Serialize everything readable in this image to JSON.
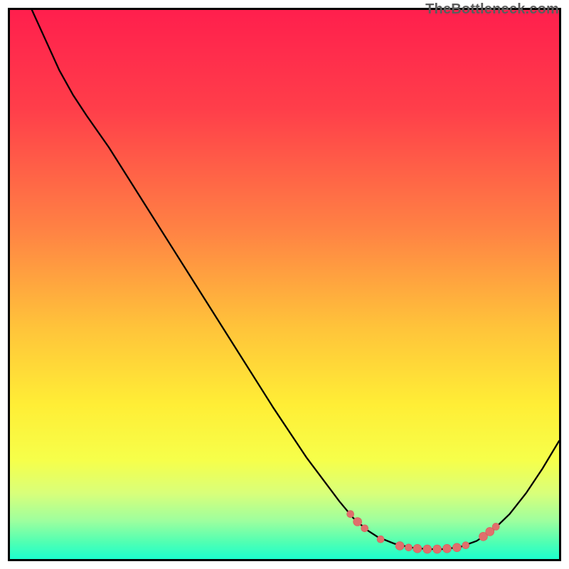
{
  "watermark": "TheBottleneck.com",
  "chart_data": {
    "type": "line",
    "title": "",
    "xlabel": "",
    "ylabel": "",
    "xlim": [
      0,
      100
    ],
    "ylim": [
      0,
      100
    ],
    "gradient_stops": [
      {
        "offset": 0,
        "color": "#ff1f4d"
      },
      {
        "offset": 18,
        "color": "#ff3e4a"
      },
      {
        "offset": 40,
        "color": "#ff8244"
      },
      {
        "offset": 58,
        "color": "#ffc43a"
      },
      {
        "offset": 72,
        "color": "#ffee36"
      },
      {
        "offset": 82,
        "color": "#f6ff4a"
      },
      {
        "offset": 88,
        "color": "#d9ff7a"
      },
      {
        "offset": 93,
        "color": "#9eff9e"
      },
      {
        "offset": 97,
        "color": "#4fffb3"
      },
      {
        "offset": 100,
        "color": "#1cffce"
      }
    ],
    "curve": [
      {
        "x": 4.0,
        "y": 100.0
      },
      {
        "x": 6.5,
        "y": 94.5
      },
      {
        "x": 9.0,
        "y": 89.0
      },
      {
        "x": 11.5,
        "y": 84.5
      },
      {
        "x": 14.0,
        "y": 80.7
      },
      {
        "x": 18.0,
        "y": 75.0
      },
      {
        "x": 24.0,
        "y": 65.5
      },
      {
        "x": 30.0,
        "y": 56.0
      },
      {
        "x": 36.0,
        "y": 46.5
      },
      {
        "x": 42.0,
        "y": 37.0
      },
      {
        "x": 48.0,
        "y": 27.5
      },
      {
        "x": 54.0,
        "y": 18.5
      },
      {
        "x": 60.0,
        "y": 10.5
      },
      {
        "x": 62.5,
        "y": 7.5
      },
      {
        "x": 65.0,
        "y": 5.3
      },
      {
        "x": 67.0,
        "y": 4.0
      },
      {
        "x": 70.0,
        "y": 2.8
      },
      {
        "x": 73.0,
        "y": 2.1
      },
      {
        "x": 76.0,
        "y": 1.8
      },
      {
        "x": 79.0,
        "y": 1.8
      },
      {
        "x": 82.0,
        "y": 2.2
      },
      {
        "x": 85.0,
        "y": 3.3
      },
      {
        "x": 88.0,
        "y": 5.3
      },
      {
        "x": 91.0,
        "y": 8.2
      },
      {
        "x": 94.0,
        "y": 12.0
      },
      {
        "x": 97.0,
        "y": 16.5
      },
      {
        "x": 100.0,
        "y": 21.5
      }
    ],
    "markers": [
      {
        "x": 62.0,
        "y": 8.2,
        "r": 5
      },
      {
        "x": 63.3,
        "y": 6.8,
        "r": 6
      },
      {
        "x": 64.6,
        "y": 5.6,
        "r": 5
      },
      {
        "x": 67.5,
        "y": 3.6,
        "r": 5
      },
      {
        "x": 71.0,
        "y": 2.4,
        "r": 6
      },
      {
        "x": 72.6,
        "y": 2.1,
        "r": 5
      },
      {
        "x": 74.2,
        "y": 1.9,
        "r": 6
      },
      {
        "x": 76.0,
        "y": 1.8,
        "r": 6
      },
      {
        "x": 77.8,
        "y": 1.8,
        "r": 6
      },
      {
        "x": 79.6,
        "y": 1.9,
        "r": 6
      },
      {
        "x": 81.4,
        "y": 2.1,
        "r": 6
      },
      {
        "x": 83.0,
        "y": 2.5,
        "r": 5
      },
      {
        "x": 86.2,
        "y": 4.1,
        "r": 6
      },
      {
        "x": 87.4,
        "y": 5.0,
        "r": 6
      },
      {
        "x": 88.5,
        "y": 5.9,
        "r": 5
      }
    ]
  }
}
